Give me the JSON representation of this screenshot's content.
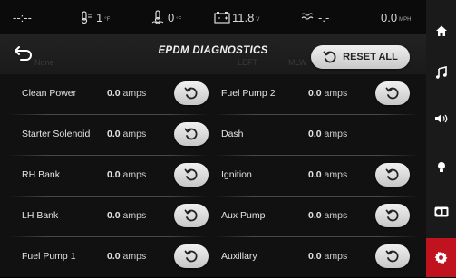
{
  "status": {
    "time": "--:--",
    "oil_pressure": "1",
    "oil_pressure_unit": "°F",
    "water_temp": "0",
    "water_temp_unit": "°F",
    "voltage": "11.8",
    "voltage_unit": "V",
    "extra_readout": "-.-",
    "speed": "0.0",
    "speed_unit": "MPH"
  },
  "header": {
    "title": "EPDM DIAGNOSTICS",
    "reset_all_label": "RESET ALL",
    "ghost_items": [
      "None",
      "LEFT",
      "MLW"
    ]
  },
  "circuits": [
    {
      "left": {
        "name": "Clean Power",
        "value": "0.0",
        "unit": "amps",
        "resettable": true
      },
      "right": {
        "name": "Fuel Pump 2",
        "value": "0.0",
        "unit": "amps",
        "resettable": true
      }
    },
    {
      "left": {
        "name": "Starter Solenoid",
        "value": "0.0",
        "unit": "amps",
        "resettable": true
      },
      "right": {
        "name": "Dash",
        "value": "0.0",
        "unit": "amps",
        "resettable": false
      }
    },
    {
      "left": {
        "name": "RH Bank",
        "value": "0.0",
        "unit": "amps",
        "resettable": true
      },
      "right": {
        "name": "Ignition",
        "value": "0.0",
        "unit": "amps",
        "resettable": true
      }
    },
    {
      "left": {
        "name": "LH Bank",
        "value": "0.0",
        "unit": "amps",
        "resettable": true
      },
      "right": {
        "name": "Aux Pump",
        "value": "0.0",
        "unit": "amps",
        "resettable": true
      }
    },
    {
      "left": {
        "name": "Fuel Pump 1",
        "value": "0.0",
        "unit": "amps",
        "resettable": true
      },
      "right": {
        "name": "Auxillary",
        "value": "0.0",
        "unit": "amps",
        "resettable": true
      }
    }
  ],
  "sidebar": {
    "items": [
      {
        "icon": "home-icon"
      },
      {
        "icon": "music-note-icon"
      },
      {
        "icon": "speaker-icon"
      },
      {
        "icon": "light-bulb-icon"
      },
      {
        "icon": "gauge-display-icon"
      },
      {
        "icon": "settings-gear-icon",
        "active": true
      }
    ]
  },
  "colors": {
    "accent": "#c1121f",
    "background": "#111111",
    "button": "#e0e0e0"
  }
}
